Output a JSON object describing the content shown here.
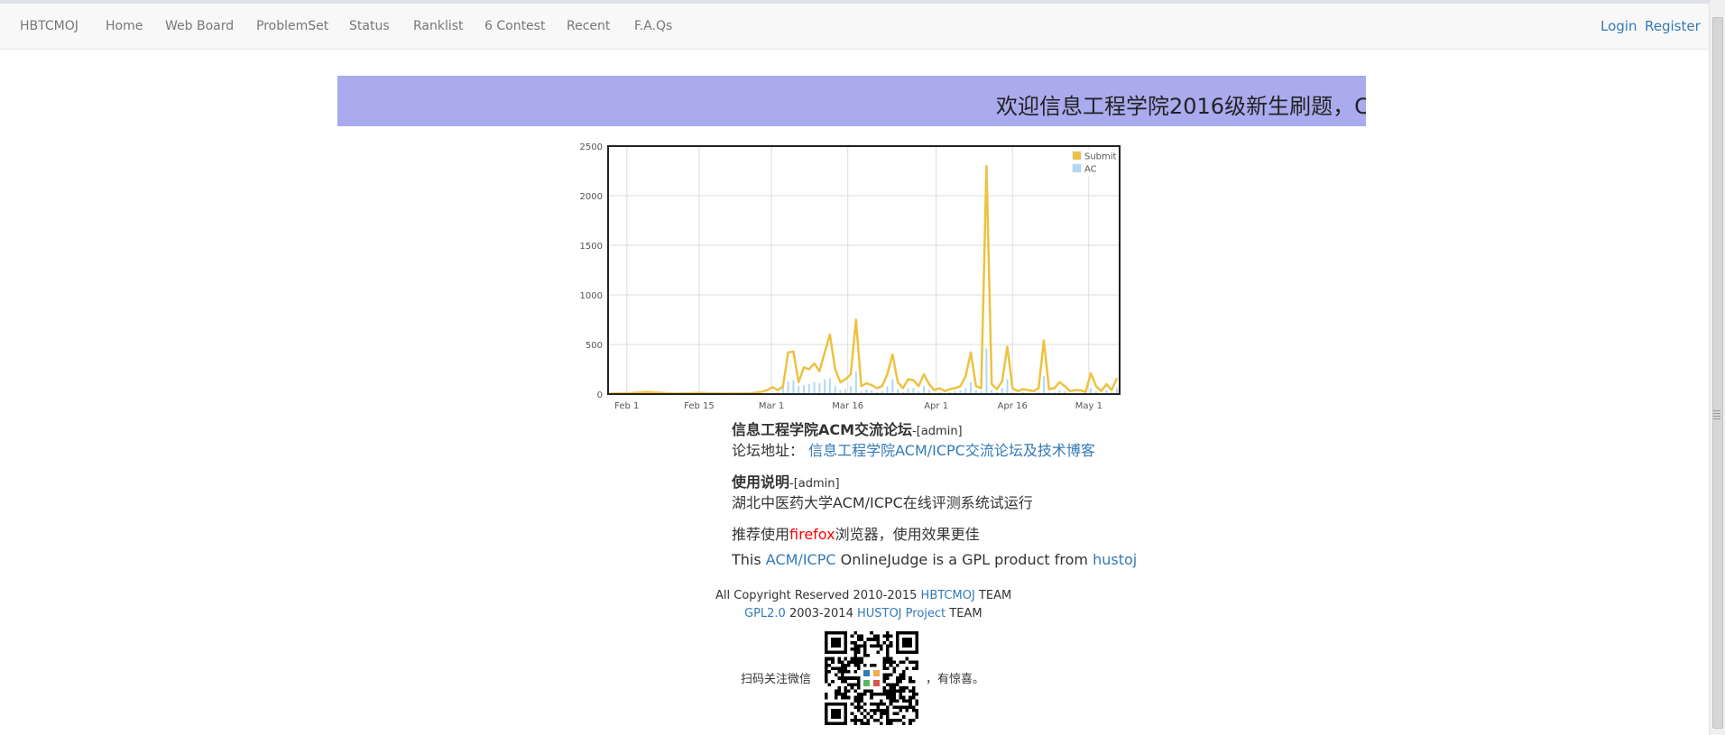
{
  "nav": {
    "brand": "HBTCMOJ",
    "items": [
      "Home",
      "Web Board",
      "ProblemSet",
      "Status",
      "Ranklist",
      "6 Contest",
      "Recent",
      "F.A.Qs"
    ],
    "login": "Login",
    "register": "Register"
  },
  "banner": {
    "text": "欢迎信息工程学院2016级新生刷题，C",
    "color": "#aaaaee"
  },
  "chart_data": {
    "type": "line",
    "yticks": [
      "0",
      "500",
      "1000",
      "1500",
      "2000",
      "2500"
    ],
    "ylim": [
      0,
      2500
    ],
    "xticks": [
      "Feb 1",
      "Feb 15",
      "Mar 1",
      "Mar 16",
      "Apr 1",
      "Apr 16",
      "May 1"
    ],
    "legend_position": "top-right",
    "grid": true,
    "series": [
      {
        "name": "Submit",
        "color": "#edc240",
        "values": [
          5,
          5,
          6,
          8,
          10,
          15,
          18,
          20,
          18,
          15,
          12,
          8,
          5,
          5,
          6,
          8,
          10,
          12,
          10,
          8,
          6,
          5,
          5,
          6,
          5,
          6,
          8,
          10,
          15,
          25,
          40,
          70,
          40,
          80,
          420,
          430,
          120,
          270,
          250,
          310,
          230,
          420,
          600,
          250,
          120,
          150,
          200,
          750,
          80,
          110,
          90,
          60,
          80,
          200,
          400,
          120,
          60,
          150,
          140,
          80,
          200,
          100,
          40,
          60,
          30,
          50,
          60,
          80,
          180,
          420,
          80,
          60,
          2300,
          100,
          50,
          130,
          480,
          60,
          30,
          50,
          40,
          30,
          60,
          540,
          50,
          60,
          120,
          80,
          30,
          40,
          40,
          20,
          210,
          80,
          30,
          100,
          40,
          160
        ]
      },
      {
        "name": "AC",
        "color": "#afd8f8",
        "values": [
          0,
          0,
          0,
          0,
          0,
          0,
          0,
          0,
          0,
          0,
          0,
          0,
          0,
          0,
          0,
          0,
          0,
          0,
          0,
          0,
          0,
          0,
          0,
          0,
          0,
          0,
          0,
          0,
          0,
          0,
          0,
          0,
          20,
          100,
          130,
          140,
          80,
          90,
          100,
          120,
          110,
          150,
          160,
          80,
          40,
          50,
          80,
          230,
          30,
          50,
          40,
          20,
          30,
          80,
          150,
          50,
          20,
          60,
          60,
          30,
          80,
          40,
          15,
          20,
          10,
          20,
          30,
          40,
          60,
          120,
          40,
          30,
          460,
          40,
          20,
          60,
          150,
          20,
          10,
          20,
          10,
          10,
          20,
          180,
          20,
          20,
          40,
          30,
          10,
          10,
          10,
          5,
          60,
          30,
          10,
          40,
          20,
          60
        ]
      }
    ]
  },
  "news": [
    {
      "title": "信息工程学院ACM交流论坛",
      "author": "-[admin]",
      "body_prefix": "论坛地址：",
      "body_link": "信息工程学院ACM/ICPC交流论坛及技术博客"
    },
    {
      "title": "使用说明",
      "author": "-[admin]",
      "line1": "湖北中医药大学ACM/ICPC在线评测系统试运行",
      "line2_prefix": "推荐使用",
      "line2_highlight": "firefox",
      "line2_suffix": "浏览器，使用效果更佳",
      "line3_prefix": "This ",
      "line3_link1": "ACM/ICPC",
      "line3_mid": " OnlineJudge is a GPL product from ",
      "line3_link2": "hustoj"
    }
  ],
  "footer": {
    "copyright_prefix": "All Copyright Reserved 2010-2015 ",
    "copyright_link": "HBTCMOJ",
    "copyright_suffix": " TEAM",
    "gpl_link": "GPL2.0",
    "gpl_years": " 2003-2014 ",
    "hustoj_link": "HUSTOJ Project",
    "gpl_suffix": " TEAM",
    "wechat_prefix": "扫码关注微信",
    "wechat_suffix": "，有惊喜。"
  }
}
